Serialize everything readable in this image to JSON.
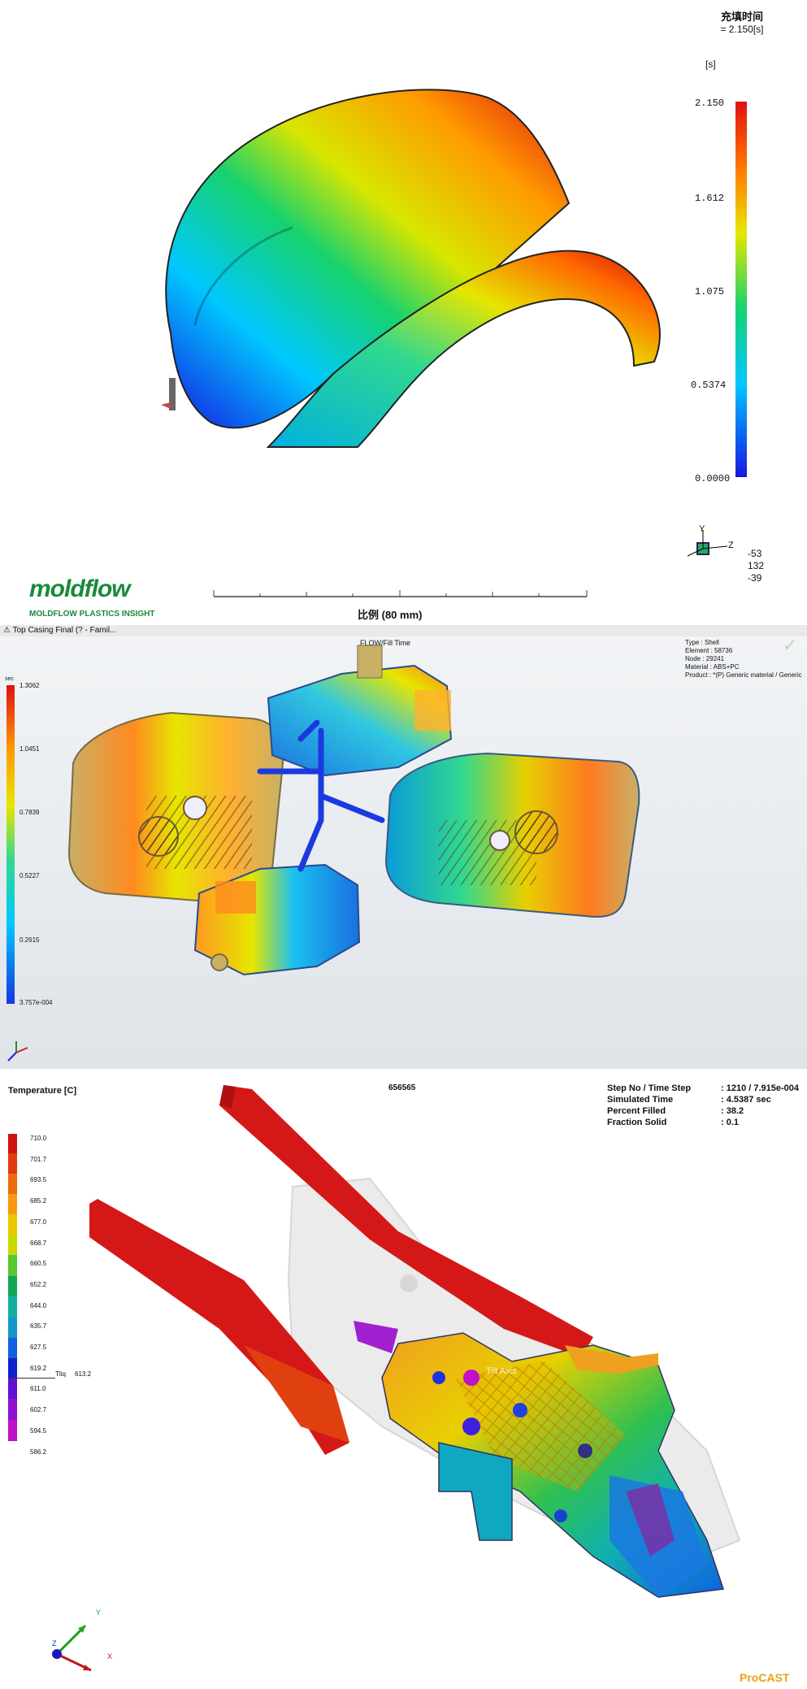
{
  "panel1": {
    "header_title": "充填时间",
    "header_value": "= 2.150[s]",
    "legend_unit": "[s]",
    "legend_ticks": [
      "2.150",
      "1.612",
      "1.075",
      "0.5374",
      "0.0000"
    ],
    "axis_values": [
      "-53",
      "132",
      "-39"
    ],
    "axis_labels": {
      "y": "Y",
      "z": "Z"
    },
    "scale_label": "比例 (80 mm)",
    "logo_text": "moldflow",
    "logo_subtext": "MOLDFLOW PLASTICS INSIGHT"
  },
  "panel2": {
    "window_title": "Top Casing Final (? - Famil...",
    "plot_title": "FLOW/Fill Time",
    "legend_unit": "sec",
    "legend_ticks": [
      "1.3062",
      "1.0451",
      "0.7839",
      "0.5227",
      "0.2615",
      "3.757e-004"
    ],
    "info": [
      "Type : Shell",
      "Element : 58736",
      "Node : 29241",
      "Material : ABS+PC",
      "Product : *(P) Generic material / Generic"
    ]
  },
  "panel3": {
    "legend_title": "Temperature  [C]",
    "plot_id": "656565",
    "legend_ticks": [
      "710.0",
      "701.7",
      "693.5",
      "685.2",
      "677.0",
      "668.7",
      "660.5",
      "652.2",
      "644.0",
      "635.7",
      "627.5",
      "619.2",
      "611.0",
      "602.7",
      "594.5",
      "586.2"
    ],
    "tliq_label": "Tliq",
    "tliq_value": "613.2",
    "stats": [
      {
        "label": "Step No / Time Step",
        "value": ": 1210 / 7.915e-004"
      },
      {
        "label": "Simulated Time",
        "value": ": 4.5387  sec"
      },
      {
        "label": "Percent Filled",
        "value": ": 38.2"
      },
      {
        "label": "Fraction Solid",
        "value": ": 0.1"
      }
    ],
    "tilt_label": "Tilt Axis",
    "axis_labels": {
      "x": "X",
      "y": "Y",
      "z": "Z"
    },
    "brand": "ProCAST"
  },
  "colors": {
    "rainbow": [
      "#1616e0",
      "#00c8ff",
      "#16d26e",
      "#e6e600",
      "#ff7a00",
      "#e01010"
    ],
    "procast": "#e8a21a",
    "moldflow_green": "#1a8a3a"
  }
}
